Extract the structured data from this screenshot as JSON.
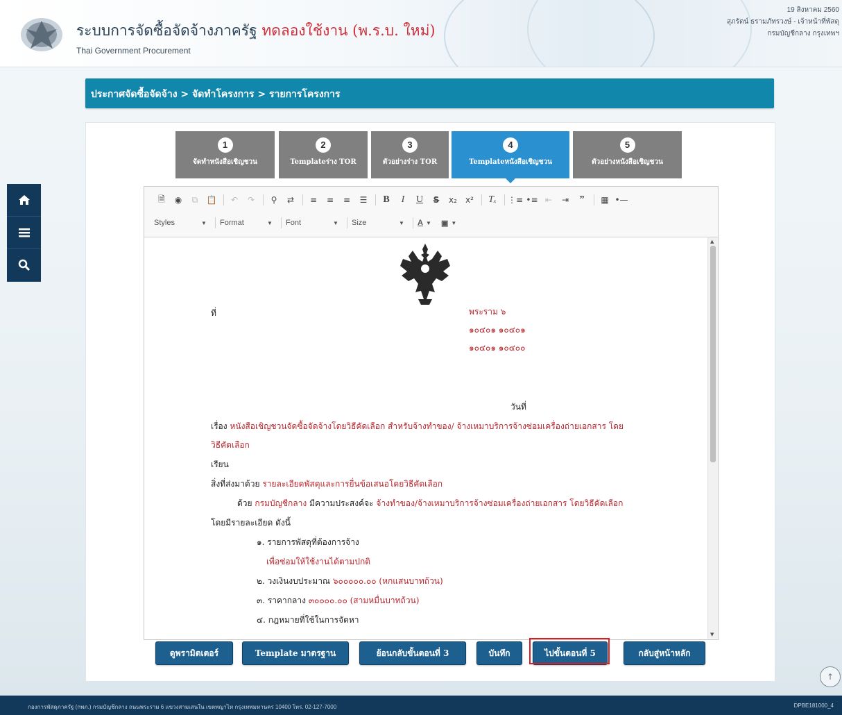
{
  "header": {
    "title_main": "ระบบการจัดซื้อจัดจ้างภาครัฐ",
    "title_trial": "ทดลองใช้งาน (พ.ร.บ. ใหม่)",
    "subtitle": "Thai Government Procurement",
    "date": "19 สิงหาคม 2560",
    "user": "สุภรัตน์ ธรามภัทรวงษ์ - เจ้าหน้าที่พัสดุ",
    "org": "กรมบัญชีกลาง กรุงเทพฯ"
  },
  "quick_nav": {
    "home_icon": "home-icon",
    "menu_icon": "menu-icon",
    "search_icon": "search-icon"
  },
  "breadcrumb": "ประกาศจัดซื้อจัดจ้าง > จัดทำโครงการ > รายการโครงการ",
  "steps": [
    {
      "num": "1",
      "label": "จัดทำหนังสือเชิญชวน",
      "active": false
    },
    {
      "num": "2",
      "label": "Templateร่าง TOR",
      "active": false
    },
    {
      "num": "3",
      "label": "ตัวอย่างร่าง TOR",
      "active": false
    },
    {
      "num": "4",
      "label": "Templateหนังสือเชิญชวน",
      "active": true
    },
    {
      "num": "5",
      "label": "ตัวอย่างหนังสือเชิญชวน",
      "active": false
    }
  ],
  "editor": {
    "styles": "Styles",
    "format": "Format",
    "font": "Font",
    "size": "Size"
  },
  "document": {
    "ref_label": "ที่",
    "address1": "พระราม ๖",
    "address2": "๑๐๔๐๑ ๑๐๔๐๑",
    "address3": "๑๐๔๐๑ ๑๐๔๐๐",
    "date_label": "วันที่",
    "subject_label": "เรื่อง",
    "subject_text": "หนังสือเชิญชวนจัดซื้อจัดจ้างโดยวิธีคัดเลือก สำหรับจ้างทำของ/ จ้างเหมาบริการจ้างซ่อมเครื่องถ่ายเอกสาร โดย",
    "subject_text2": "วิธีคัดเลือก",
    "to_label": "เรียน",
    "attach_label": "สิ่งที่ส่งมาด้วย",
    "attach_text": "รายละเอียดพัสดุและการยื่นข้อเสนอโดยวิธีคัดเลือก",
    "body_prefix": "ด้วย",
    "body_org": "กรมบัญชีกลาง",
    "body_mid": "มีความประสงค์จะ",
    "body_text": "จ้างทำของ/จ้างเหมาบริการจ้างซ่อมเครื่องถ่ายเอกสาร โดยวิธีคัดเลือก",
    "body_line2": "โดยมีรายละเอียด ดังนี้",
    "item1_label": "๑. รายการพัสดุที่ต้องการจ้าง",
    "item1_text": "เพื่อซ่อมให้ใช้งานได้ตามปกติ",
    "item2_label": "๒. วงเงินงบประมาณ",
    "item2_text": "๖๐๐๐๐๐.๐๐ (หกแสนบาทถ้วน)",
    "item3_label": "๓. ราคากลาง",
    "item3_text": "๓๐๐๐๐.๐๐ (สามหมื่นบาทถ้วน)",
    "item4_partial": "๔. กฎหมายที่ใช้ในการจัดหา"
  },
  "actions": {
    "preview": "ดูพรามิตเตอร์",
    "template": "Template มาตรฐาน",
    "back_step": "ย้อนกลับขั้นตอนที่ 3",
    "save": "บันทึก",
    "next_step": "ไปขั้นตอนที่ 5",
    "home": "กลับสู่หน้าหลัก"
  },
  "footer": {
    "address": "กองการพัสดุภาครัฐ (กพภ.) กรมบัญชีกลาง ถนนพระราม 6 แขวงสามเสนใน เขตพญาไท กรุงเทพมหานคร 10400 โทร. 02-127-7000",
    "code": "DPBE181000_4"
  },
  "colors": {
    "accent": "#1187ac",
    "nav": "#12385a",
    "active_step": "#2a90d0",
    "inactive_step": "#808080",
    "button": "#1d5f8e",
    "highlight": "#d32027",
    "doc_red": "#b8262e"
  }
}
